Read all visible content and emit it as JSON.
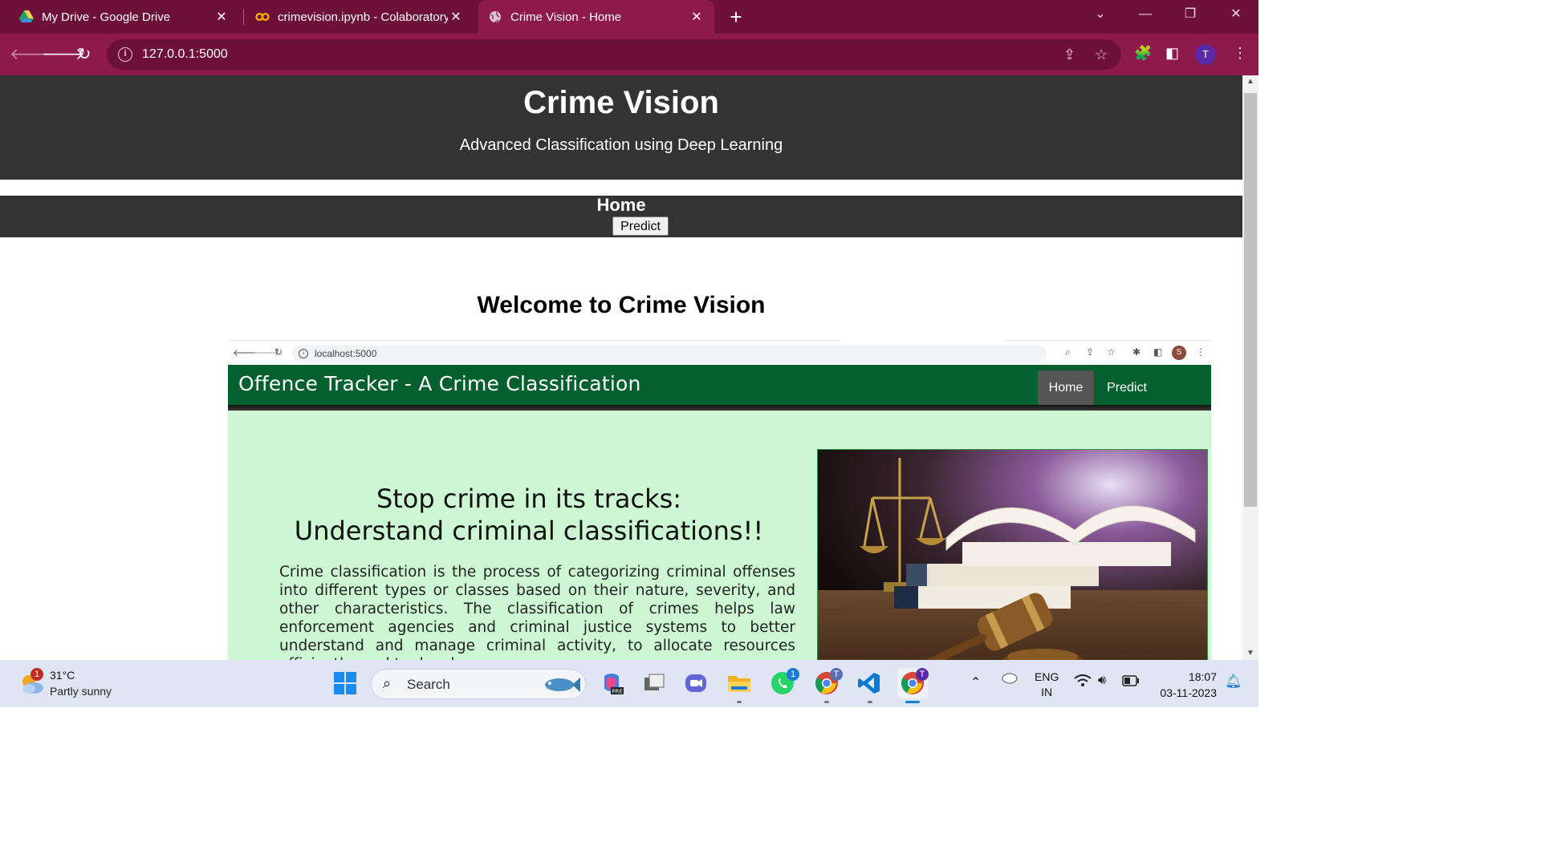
{
  "browser": {
    "tabs": [
      {
        "title": "My Drive - Google Drive",
        "icon": "google-drive-icon"
      },
      {
        "title": "crimevision.ipynb - Colaboratory",
        "icon": "colab-icon"
      },
      {
        "title": "Crime Vision - Home",
        "icon": "globe-icon",
        "active": true
      }
    ],
    "url": "127.0.0.1:5000",
    "profile_initial": "T"
  },
  "page": {
    "header_title": "Crime Vision",
    "header_subtitle": "Advanced Classification using Deep Learning",
    "nav_home": "Home",
    "nav_predict": "Predict",
    "welcome": "Welcome to Crime Vision"
  },
  "embedded": {
    "url": "localhost:5000",
    "profile_initial": "S",
    "brand": "Offence Tracker - A Crime Classification",
    "nav_home": "Home",
    "nav_predict": "Predict",
    "hero_line1": "Stop crime in its tracks:",
    "hero_line2": "Understand criminal classifications!!",
    "paragraph": "Crime classification is the process of categorizing criminal offenses into different types or classes based on their nature, severity, and other characteristics. The classification of crimes helps law enforcement agencies and criminal justice systems to better understand and manage criminal activity, to allocate resources efficiently, and to develop",
    "image": "scales-of-justice-books-gavel-image",
    "accent_color": "#04602e",
    "body_color": "#cdf7d3"
  },
  "taskbar": {
    "weather_temp": "31°C",
    "weather_desc": "Partly sunny",
    "weather_badge": "1",
    "search_label": "Search",
    "whatsapp_badge": "1",
    "lang_line1": "ENG",
    "lang_line2": "IN",
    "time": "18:07",
    "date": "03-11-2023"
  },
  "colors": {
    "tab_bar": "#6d1138",
    "toolbar": "#8e1a4c",
    "page_header": "#333333"
  }
}
